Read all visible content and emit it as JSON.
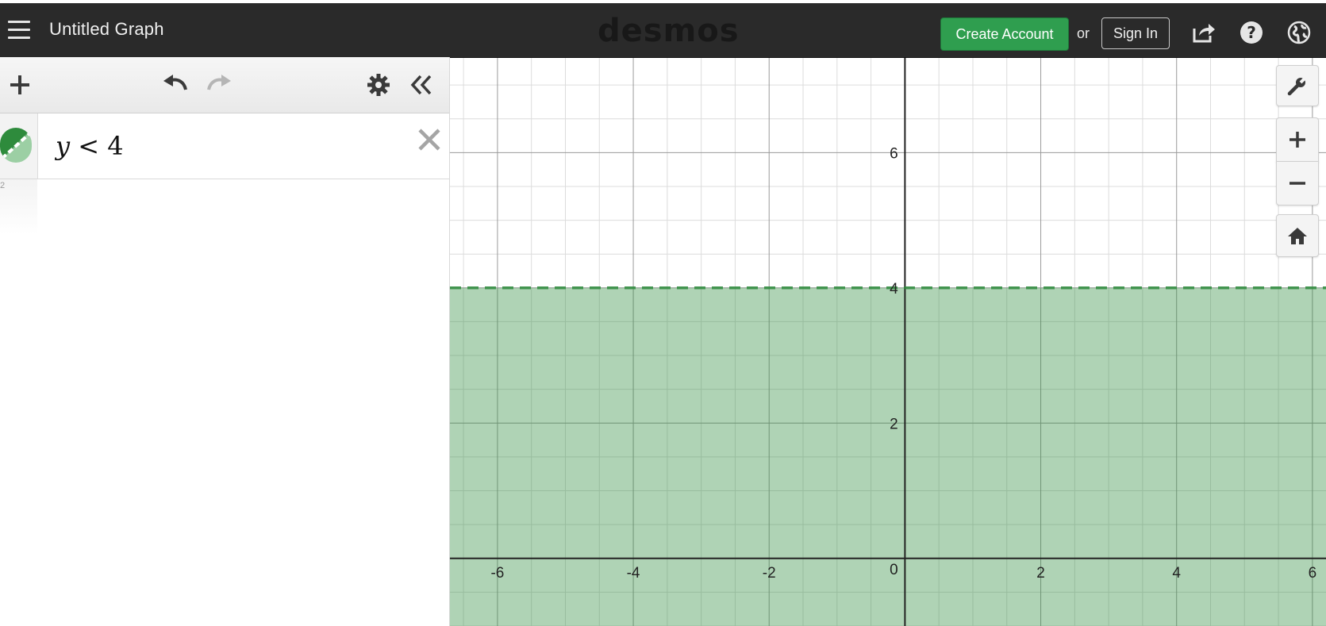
{
  "header": {
    "title": "Untitled Graph",
    "brand": "desmos",
    "create_account_label": "Create Account",
    "or_label": "or",
    "sign_in_label": "Sign In",
    "icons": [
      "menu-icon",
      "share-icon",
      "help-icon",
      "globe-icon"
    ]
  },
  "panel": {
    "toolbar_icons": [
      "add-icon",
      "undo-icon",
      "redo-icon",
      "settings-icon",
      "collapse-icon"
    ],
    "expressions": [
      {
        "var": "y",
        "op": "<",
        "value": "4",
        "color": "#2e8b3c",
        "line_style": "dashed"
      }
    ],
    "empty_row_number": "2"
  },
  "graph_controls": [
    "wrench-icon",
    "zoom-in-icon",
    "zoom-out-icon",
    "home-icon"
  ],
  "colors": {
    "accent": "#2f9e4f",
    "shade": "#2e8b3c",
    "header_bg": "#2a2a2a"
  },
  "chart_data": {
    "type": "area",
    "xlim": [
      -6.7,
      6.2
    ],
    "ylim": [
      -1,
      7.4
    ],
    "x_ticks": [
      -6,
      -4,
      -2,
      2,
      4,
      6
    ],
    "y_ticks": [
      2,
      4,
      6
    ],
    "origin_label": "0",
    "grid": true,
    "minor_grid_step": 0.5,
    "inequality": {
      "expression": "y < 4",
      "boundary": 4,
      "shade": "below",
      "dashed": true
    }
  }
}
